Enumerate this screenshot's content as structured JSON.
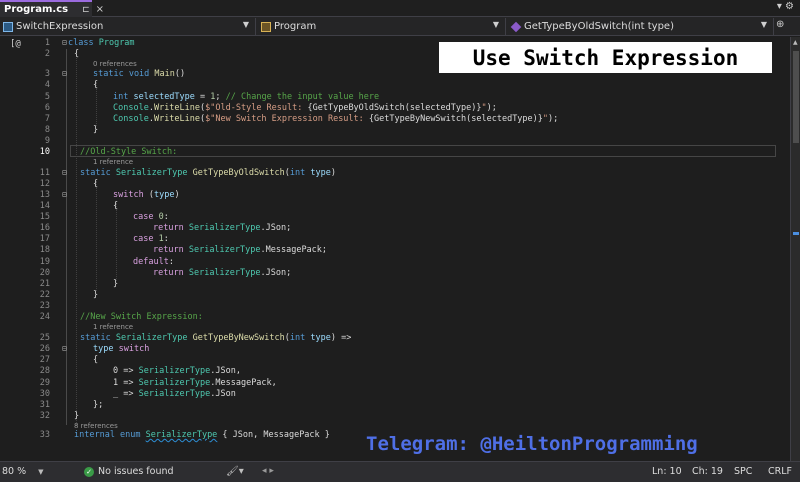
{
  "tab": {
    "label": "Program.cs",
    "pin": "⊏",
    "close": "×"
  },
  "navbar": {
    "project": "SwitchExpression",
    "class": "Program",
    "member": "GetTypeByOldSwitch(int type)"
  },
  "overlay": {
    "title": "Use Switch Expression",
    "telegram": "Telegram: @HeiltonProgramming"
  },
  "editor": {
    "gutter_glyph": "[@",
    "lines": [
      {
        "num": "1"
      },
      {
        "num": "2"
      },
      {
        "num": "3"
      },
      {
        "num": "4"
      },
      {
        "num": "5"
      },
      {
        "num": "6"
      },
      {
        "num": "7"
      },
      {
        "num": "8"
      },
      {
        "num": "9"
      },
      {
        "num": "10",
        "active": true
      },
      {
        "num": "11"
      },
      {
        "num": "12"
      },
      {
        "num": "13"
      },
      {
        "num": "14"
      },
      {
        "num": "15"
      },
      {
        "num": "16"
      },
      {
        "num": "17"
      },
      {
        "num": "18"
      },
      {
        "num": "19"
      },
      {
        "num": "20"
      },
      {
        "num": "21"
      },
      {
        "num": "22"
      },
      {
        "num": "23"
      },
      {
        "num": "24"
      },
      {
        "num": "25"
      },
      {
        "num": "26"
      },
      {
        "num": "27"
      },
      {
        "num": "28"
      },
      {
        "num": "29"
      },
      {
        "num": "30"
      },
      {
        "num": "31"
      },
      {
        "num": "32"
      },
      {
        "num": "33"
      }
    ],
    "lens": {
      "main": "0 references",
      "old": "1 reference",
      "new": "1 reference",
      "enum": "8 references"
    },
    "code": {
      "l1_kw": "class",
      "l1_name": "Program",
      "l2": "{",
      "l3_a": "static void",
      "l3_b": "Main",
      "l3_c": "()",
      "l4": "{",
      "l5_a": "int",
      "l5_b": "selectedType",
      "l5_c": " = ",
      "l5_d": "1",
      "l5_e": ";",
      "l5_f": " // Change the input value here",
      "l6_a": "Console",
      "l6_b": ".",
      "l6_c": "WriteLine",
      "l6_d": "(",
      "l6_e": "$\"Old-Style Result: ",
      "l6_f": "{GetTypeByOldSwitch(selectedType)}",
      "l6_g": "\"",
      "l6_h": ");",
      "l7_a": "Console",
      "l7_b": ".",
      "l7_c": "WriteLine",
      "l7_d": "(",
      "l7_e": "$\"New Switch Expression Result: ",
      "l7_f": "{GetTypeByNewSwitch(selectedType)}",
      "l7_g": "\"",
      "l7_h": ");",
      "l8": "}",
      "l10": "//Old-Style Switch:",
      "l11_a": "static",
      "l11_b": "SerializerType",
      "l11_c": "GetTypeByOldSwitch",
      "l11_d": "(",
      "l11_e": "int",
      "l11_f": "type",
      "l11_g": ")",
      "l12": "{",
      "l13_a": "switch",
      "l13_b": " (",
      "l13_c": "type",
      "l13_d": ")",
      "l14": "{",
      "l15_a": "case",
      "l15_b": "0",
      "l15_c": ":",
      "l16_a": "return",
      "l16_b": "SerializerType",
      "l16_c": ".JSon;",
      "l17_a": "case",
      "l17_b": "1",
      "l17_c": ":",
      "l18_a": "return",
      "l18_b": "SerializerType",
      "l18_c": ".MessagePack;",
      "l19_a": "default",
      "l19_b": ":",
      "l20_a": "return",
      "l20_b": "SerializerType",
      "l20_c": ".JSon;",
      "l21": "}",
      "l22": "}",
      "l24": "//New Switch Expression:",
      "l25_a": "static",
      "l25_b": "SerializerType",
      "l25_c": "GetTypeByNewSwitch",
      "l25_d": "(",
      "l25_e": "int",
      "l25_f": "type",
      "l25_g": ") =>",
      "l26_a": "type",
      "l26_b": "switch",
      "l27": "{",
      "l28_a": "0 => ",
      "l28_b": "SerializerType",
      "l28_c": ".JSon,",
      "l29_a": "1 => ",
      "l29_b": "SerializerType",
      "l29_c": ".MessagePack,",
      "l30_a": "_ => ",
      "l30_b": "SerializerType",
      "l30_c": ".JSon",
      "l31": "};",
      "l32": "}",
      "l33_a": "internal enum",
      "l33_b": "SerializerType",
      "l33_c": " { JSon, MessagePack }"
    }
  },
  "statusbar": {
    "zoom": "80 %",
    "issues": "No issues found",
    "ln": "Ln: 10",
    "ch": "Ch: 19",
    "spc": "SPC",
    "crlf": "CRLF"
  }
}
